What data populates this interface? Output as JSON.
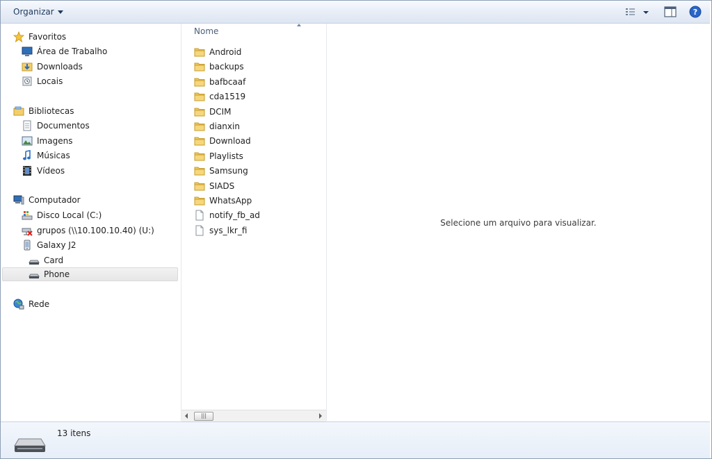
{
  "toolbar": {
    "organize_label": "Organizar",
    "icons": {
      "views": "view-options-icon",
      "preview_pane": "preview-pane-icon",
      "help": "help-icon"
    },
    "help_color": "#2a66c8"
  },
  "nav": {
    "favorites": {
      "header": "Favoritos",
      "items": [
        {
          "label": "Área de Trabalho",
          "icon": "desktop-icon"
        },
        {
          "label": "Downloads",
          "icon": "downloads-icon"
        },
        {
          "label": "Locais",
          "icon": "recent-places-icon"
        }
      ]
    },
    "libraries": {
      "header": "Bibliotecas",
      "items": [
        {
          "label": "Documentos",
          "icon": "documents-icon"
        },
        {
          "label": "Imagens",
          "icon": "pictures-icon"
        },
        {
          "label": "Músicas",
          "icon": "music-icon"
        },
        {
          "label": "Vídeos",
          "icon": "videos-icon"
        }
      ]
    },
    "computer": {
      "header": "Computador",
      "items": [
        {
          "label": "Disco Local (C:)",
          "icon": "local-disk-icon"
        },
        {
          "label": "grupos (\\\\10.100.10.40) (U:)",
          "icon": "network-drive-disconnected-icon"
        },
        {
          "label": "Galaxy J2",
          "icon": "phone-device-icon"
        },
        {
          "label": "Card",
          "icon": "storage-icon"
        },
        {
          "label": "Phone",
          "icon": "storage-icon",
          "selected": true
        }
      ]
    },
    "network": {
      "header": "Rede",
      "icon": "network-icon"
    }
  },
  "files": {
    "column_header": "Nome",
    "items": [
      {
        "name": "Android",
        "type": "folder"
      },
      {
        "name": "backups",
        "type": "folder"
      },
      {
        "name": "bafbcaaf",
        "type": "folder"
      },
      {
        "name": "cda1519",
        "type": "folder"
      },
      {
        "name": "DCIM",
        "type": "folder"
      },
      {
        "name": "dianxin",
        "type": "folder"
      },
      {
        "name": "Download",
        "type": "folder"
      },
      {
        "name": "Playlists",
        "type": "folder"
      },
      {
        "name": "Samsung",
        "type": "folder"
      },
      {
        "name": "SIADS",
        "type": "folder"
      },
      {
        "name": "WhatsApp",
        "type": "folder"
      },
      {
        "name": "notify_fb_ad",
        "type": "file"
      },
      {
        "name": "sys_lkr_fi",
        "type": "file"
      }
    ]
  },
  "preview": {
    "message": "Selecione um arquivo para visualizar."
  },
  "details": {
    "count": "13 itens",
    "icon": "storage-device-icon"
  }
}
